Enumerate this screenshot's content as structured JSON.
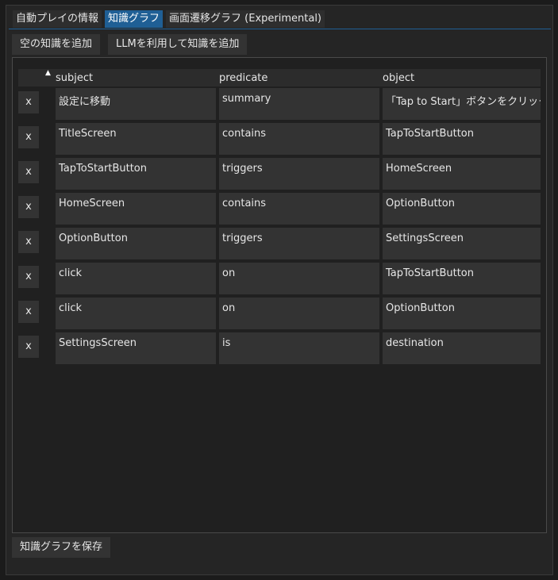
{
  "tabs": [
    {
      "label": "自動プレイの情報",
      "active": false
    },
    {
      "label": "知識グラフ",
      "active": true
    },
    {
      "label": "画面遷移グラフ (Experimental)",
      "active": false
    }
  ],
  "toolbar": {
    "add_empty_label": "空の知識を追加",
    "add_llm_label": "LLMを利用して知識を追加"
  },
  "table": {
    "sort_indicator": "▲",
    "columns": {
      "subject": "subject",
      "predicate": "predicate",
      "object": "object"
    },
    "delete_label": "x",
    "rows": [
      {
        "subject": "設定に移動",
        "predicate": "summary",
        "object": "「Tap to Start」ボタンをクリック"
      },
      {
        "subject": "TitleScreen",
        "predicate": "contains",
        "object": "TapToStartButton"
      },
      {
        "subject": "TapToStartButton",
        "predicate": "triggers",
        "object": "HomeScreen"
      },
      {
        "subject": "HomeScreen",
        "predicate": "contains",
        "object": "OptionButton"
      },
      {
        "subject": "OptionButton",
        "predicate": "triggers",
        "object": "SettingsScreen"
      },
      {
        "subject": "click",
        "predicate": "on",
        "object": "TapToStartButton"
      },
      {
        "subject": "click",
        "predicate": "on",
        "object": "OptionButton"
      },
      {
        "subject": "SettingsScreen",
        "predicate": "is",
        "object": "destination"
      }
    ]
  },
  "footer": {
    "save_label": "知識グラフを保存"
  },
  "colors": {
    "accent": "#1f5f95",
    "background": "#252525",
    "cell": "#333333"
  }
}
